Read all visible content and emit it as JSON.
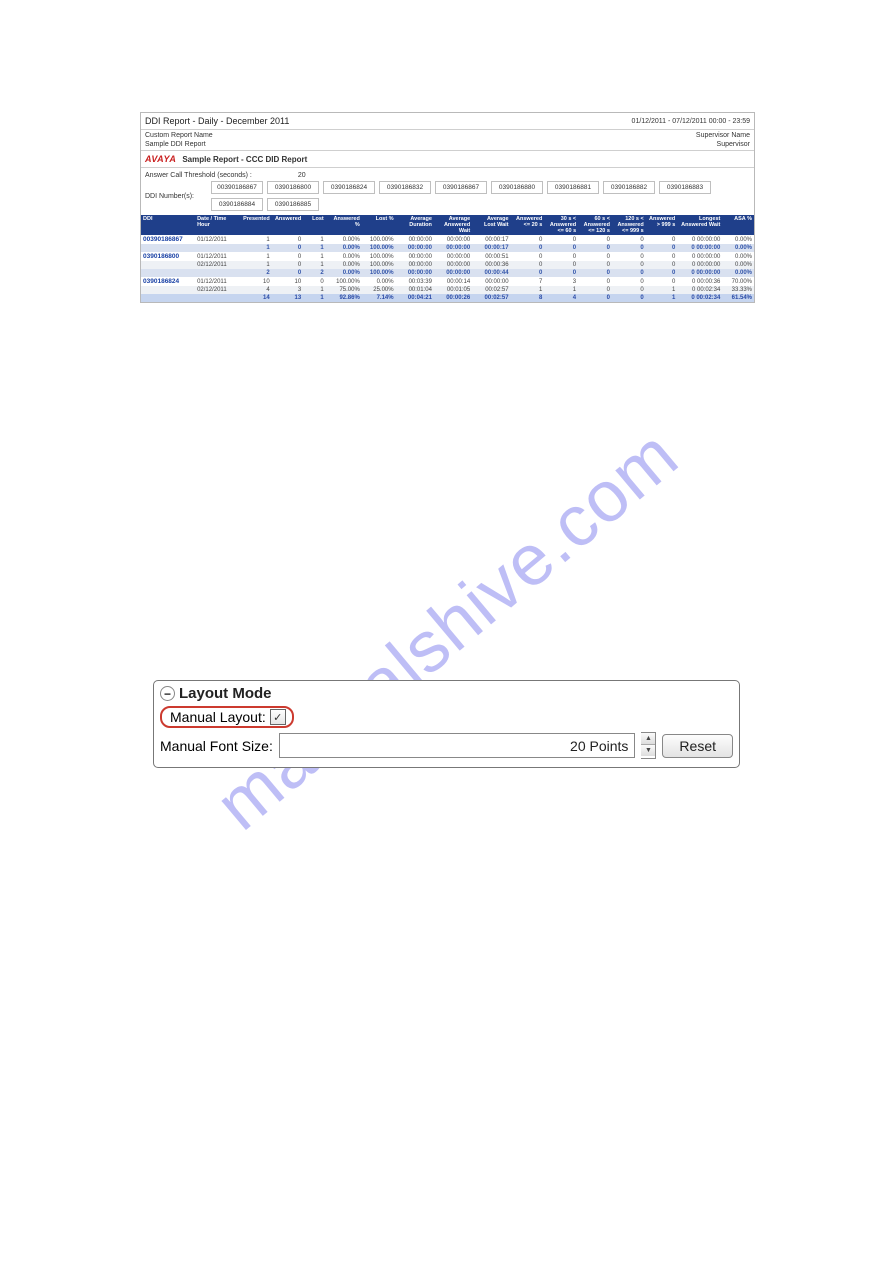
{
  "report": {
    "title": "DDI Report - Daily - December 2011",
    "date_range": "01/12/2011 - 07/12/2011   00:00  -  23:59",
    "custom_label": "Custom Report Name",
    "custom_value": "Supervisor Name",
    "sample_label": "Sample DDI Report",
    "sample_value": "Supervisor",
    "brand": "AVAYA",
    "brand_title": "Sample Report - CCC DID Report",
    "threshold_label": "Answer Call Threshold (seconds) :",
    "threshold_value": "20",
    "ddi_label": "DDI Number(s):",
    "ddi_numbers": [
      "00390186867",
      "0390186800",
      "0390186824",
      "0390186832",
      "0390186867",
      "0390186880",
      "0390186881",
      "0390186882",
      "0390186883",
      "0390186884",
      "0390186885"
    ],
    "columns": [
      "DDI",
      "Date / Time Hour",
      "Presented",
      "Answered",
      "Lost",
      "Answered %",
      "Lost %",
      "Average Duration",
      "Average Answered Wait",
      "Average Lost Wait",
      "Answered <= 20 s",
      "30 s < Answered <= 60 s",
      "60 s < Answered <= 120 s",
      "120 s < Answered <= 999 s",
      "Answered > 999 s",
      "Longest Answered Wait",
      "ASA %"
    ],
    "rows": [
      {
        "cls": "row-white",
        "cells": [
          "00390186867",
          "01/12/2011",
          "1",
          "0",
          "1",
          "0.00%",
          "100.00%",
          "00:00:00",
          "00:00:00",
          "00:00:17",
          "0",
          "0",
          "0",
          "0",
          "0",
          "0 00:00:00",
          "0.00%"
        ]
      },
      {
        "cls": "row-sum",
        "cells": [
          "",
          "",
          "1",
          "0",
          "1",
          "0.00%",
          "100.00%",
          "00:00:00",
          "00:00:00",
          "00:00:17",
          "0",
          "0",
          "0",
          "0",
          "0",
          "0 00:00:00",
          "0.00%"
        ]
      },
      {
        "cls": "row-white",
        "cells": [
          "0390186800",
          "01/12/2011",
          "1",
          "0",
          "1",
          "0.00%",
          "100.00%",
          "00:00:00",
          "00:00:00",
          "00:00:51",
          "0",
          "0",
          "0",
          "0",
          "0",
          "0 00:00:00",
          "0.00%"
        ]
      },
      {
        "cls": "row-grey",
        "cells": [
          "",
          "02/12/2011",
          "1",
          "0",
          "1",
          "0.00%",
          "100.00%",
          "00:00:00",
          "00:00:00",
          "00:00:36",
          "0",
          "0",
          "0",
          "0",
          "0",
          "0 00:00:00",
          "0.00%"
        ]
      },
      {
        "cls": "row-sum",
        "cells": [
          "",
          "",
          "2",
          "0",
          "2",
          "0.00%",
          "100.00%",
          "00:00:00",
          "00:00:00",
          "00:00:44",
          "0",
          "0",
          "0",
          "0",
          "0",
          "0 00:00:00",
          "0.00%"
        ]
      },
      {
        "cls": "row-white",
        "cells": [
          "0390186824",
          "01/12/2011",
          "10",
          "10",
          "0",
          "100.00%",
          "0.00%",
          "00:03:39",
          "00:00:14",
          "00:00:00",
          "7",
          "3",
          "0",
          "0",
          "0",
          "0 00:00:36",
          "70.00%"
        ]
      },
      {
        "cls": "row-grey",
        "cells": [
          "",
          "02/12/2011",
          "4",
          "3",
          "1",
          "75.00%",
          "25.00%",
          "00:01:04",
          "00:01:05",
          "00:02:57",
          "1",
          "1",
          "0",
          "0",
          "1",
          "0 00:02:34",
          "33.33%"
        ]
      },
      {
        "cls": "row-grand",
        "cells": [
          "",
          "",
          "14",
          "13",
          "1",
          "92.86%",
          "7.14%",
          "00:04:21",
          "00:00:26",
          "00:02:57",
          "8",
          "4",
          "0",
          "0",
          "1",
          "0 00:02:34",
          "61.54%"
        ]
      }
    ]
  },
  "watermark": "manualshive.com",
  "layout": {
    "header": "Layout Mode",
    "manual_layout_label": "Manual Layout:",
    "manual_layout_checked": true,
    "font_label": "Manual Font Size:",
    "font_value": "20 Points",
    "reset": "Reset"
  }
}
